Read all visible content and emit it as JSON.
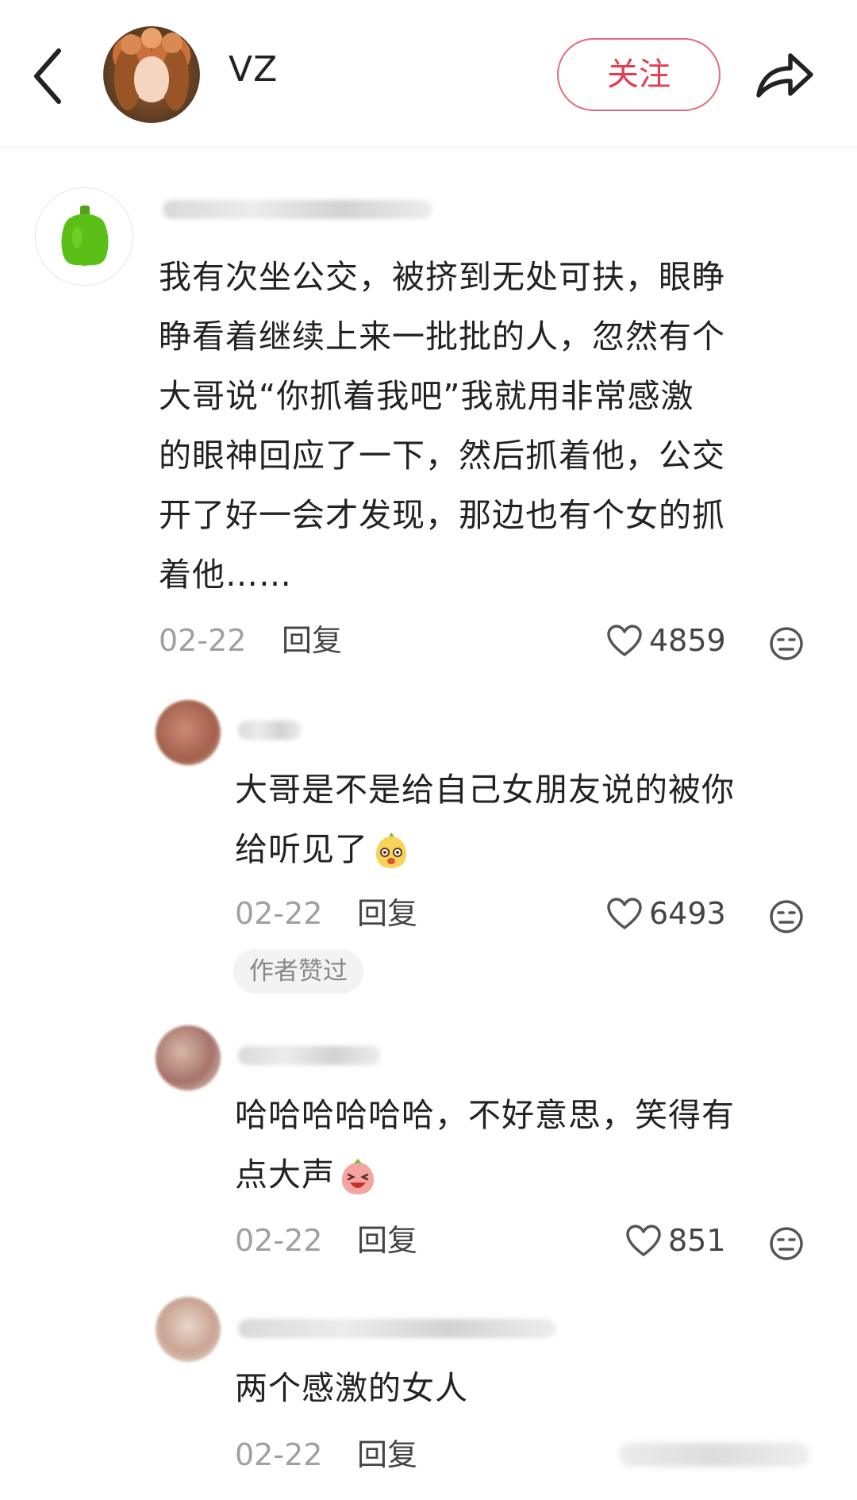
{
  "header": {
    "username": "VZ",
    "follow_label": "关注"
  },
  "comments": [
    {
      "text_lines": [
        "我有次坐公交，被挤到无处可扶，眼睁",
        "睁看着继续上来一批批的人，忽然有个",
        "大哥说“你抓着我吧”我就用非常感激",
        "的眼神回应了一下，然后抓着他，公交",
        "开了好一会才发现，那边也有个女的抓",
        "着他……"
      ],
      "date": "02-22",
      "reply_label": "回复",
      "likes": "4859"
    },
    {
      "text_lines": [
        "大哥是不是给自己女朋友说的被你",
        "给听见了"
      ],
      "date": "02-22",
      "reply_label": "回复",
      "likes": "6493",
      "badge": "作者赞过"
    },
    {
      "text_lines": [
        "哈哈哈哈哈哈，不好意思，笑得有",
        "点大声"
      ],
      "date": "02-22",
      "reply_label": "回复",
      "likes": "851"
    },
    {
      "text_lines": [
        "两个感激的女人"
      ],
      "date": "02-22",
      "reply_label": "回复"
    }
  ]
}
